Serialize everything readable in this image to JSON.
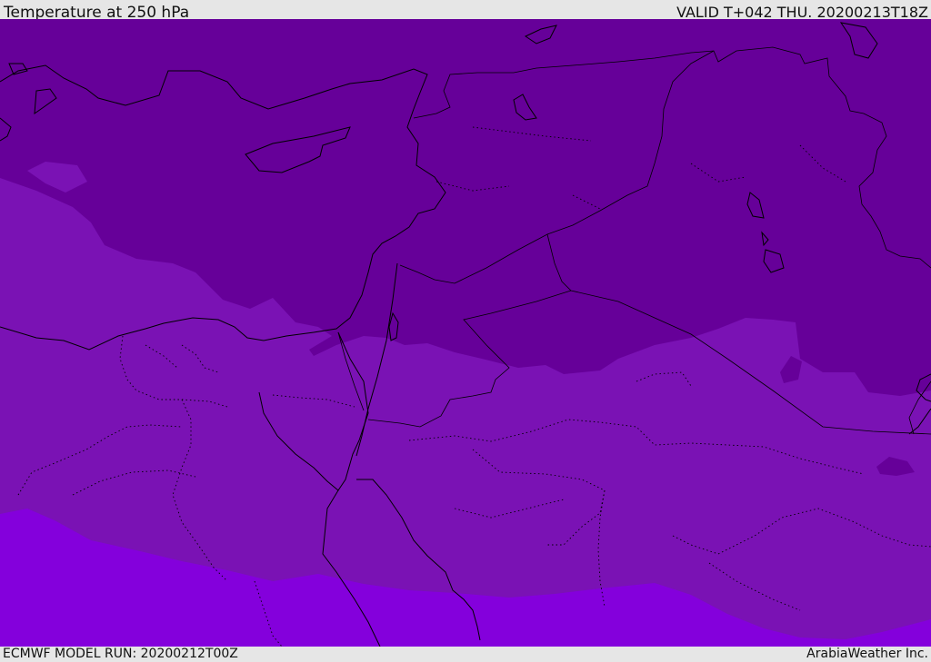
{
  "header": {
    "title": "Temperature at 250 hPa",
    "valid": "VALID T+042 THU. 20200213T18Z"
  },
  "footer": {
    "model_run": "ECMWF MODEL RUN: 20200212T00Z",
    "credit": "ArabiaWeather Inc."
  },
  "colors": {
    "band_cold": "#660099",
    "band_mid": "#7a12b4",
    "band_warm": "#8400dc",
    "coastline": "#000000"
  }
}
